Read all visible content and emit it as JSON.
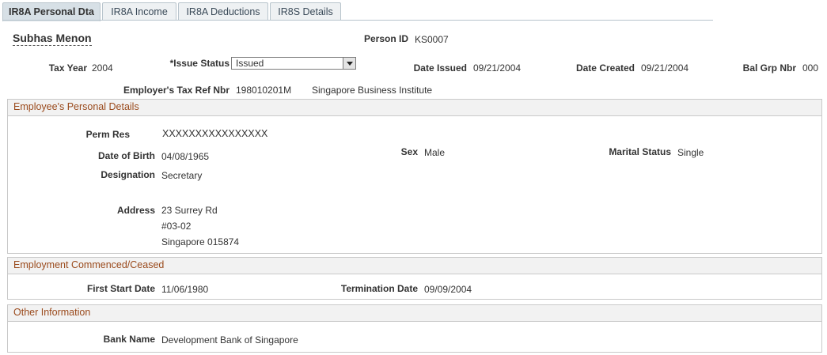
{
  "tabs": [
    {
      "label": "IR8A Personal Dta",
      "active": true
    },
    {
      "label": "IR8A Income",
      "active": false
    },
    {
      "label": "IR8A Deductions",
      "active": false
    },
    {
      "label": "IR8S Details",
      "active": false
    }
  ],
  "header": {
    "employee_name": "Subhas Menon",
    "person_id_label": "Person ID",
    "person_id": "KS0007",
    "tax_year_label": "Tax Year",
    "tax_year": "2004",
    "issue_status_label": "*Issue Status",
    "issue_status": "Issued",
    "date_issued_label": "Date Issued",
    "date_issued": "09/21/2004",
    "date_created_label": "Date Created",
    "date_created": "09/21/2004",
    "bal_grp_label": "Bal Grp Nbr",
    "bal_grp": "000",
    "tax_ref_label": "Employer's Tax Ref Nbr",
    "tax_ref": "198010201M",
    "employer_name": "Singapore Business Institute"
  },
  "personal": {
    "title": "Employee's Personal Details",
    "perm_res_label": "Perm Res",
    "perm_res": "XXXXXXXXXXXXXXXX",
    "dob_label": "Date of Birth",
    "dob": "04/08/1965",
    "sex_label": "Sex",
    "sex": "Male",
    "marital_label": "Marital Status",
    "marital": "Single",
    "designation_label": "Designation",
    "designation": "Secretary",
    "address_label": "Address",
    "address_line1": "23 Surrey Rd",
    "address_line2": "#03-02",
    "address_line3": "Singapore 015874"
  },
  "employment": {
    "title": "Employment Commenced/Ceased",
    "start_label": "First Start Date",
    "start": "11/06/1980",
    "term_label": "Termination Date",
    "term": "09/09/2004"
  },
  "other": {
    "title": "Other Information",
    "bank_label": "Bank Name",
    "bank": "Development Bank of Singapore"
  }
}
